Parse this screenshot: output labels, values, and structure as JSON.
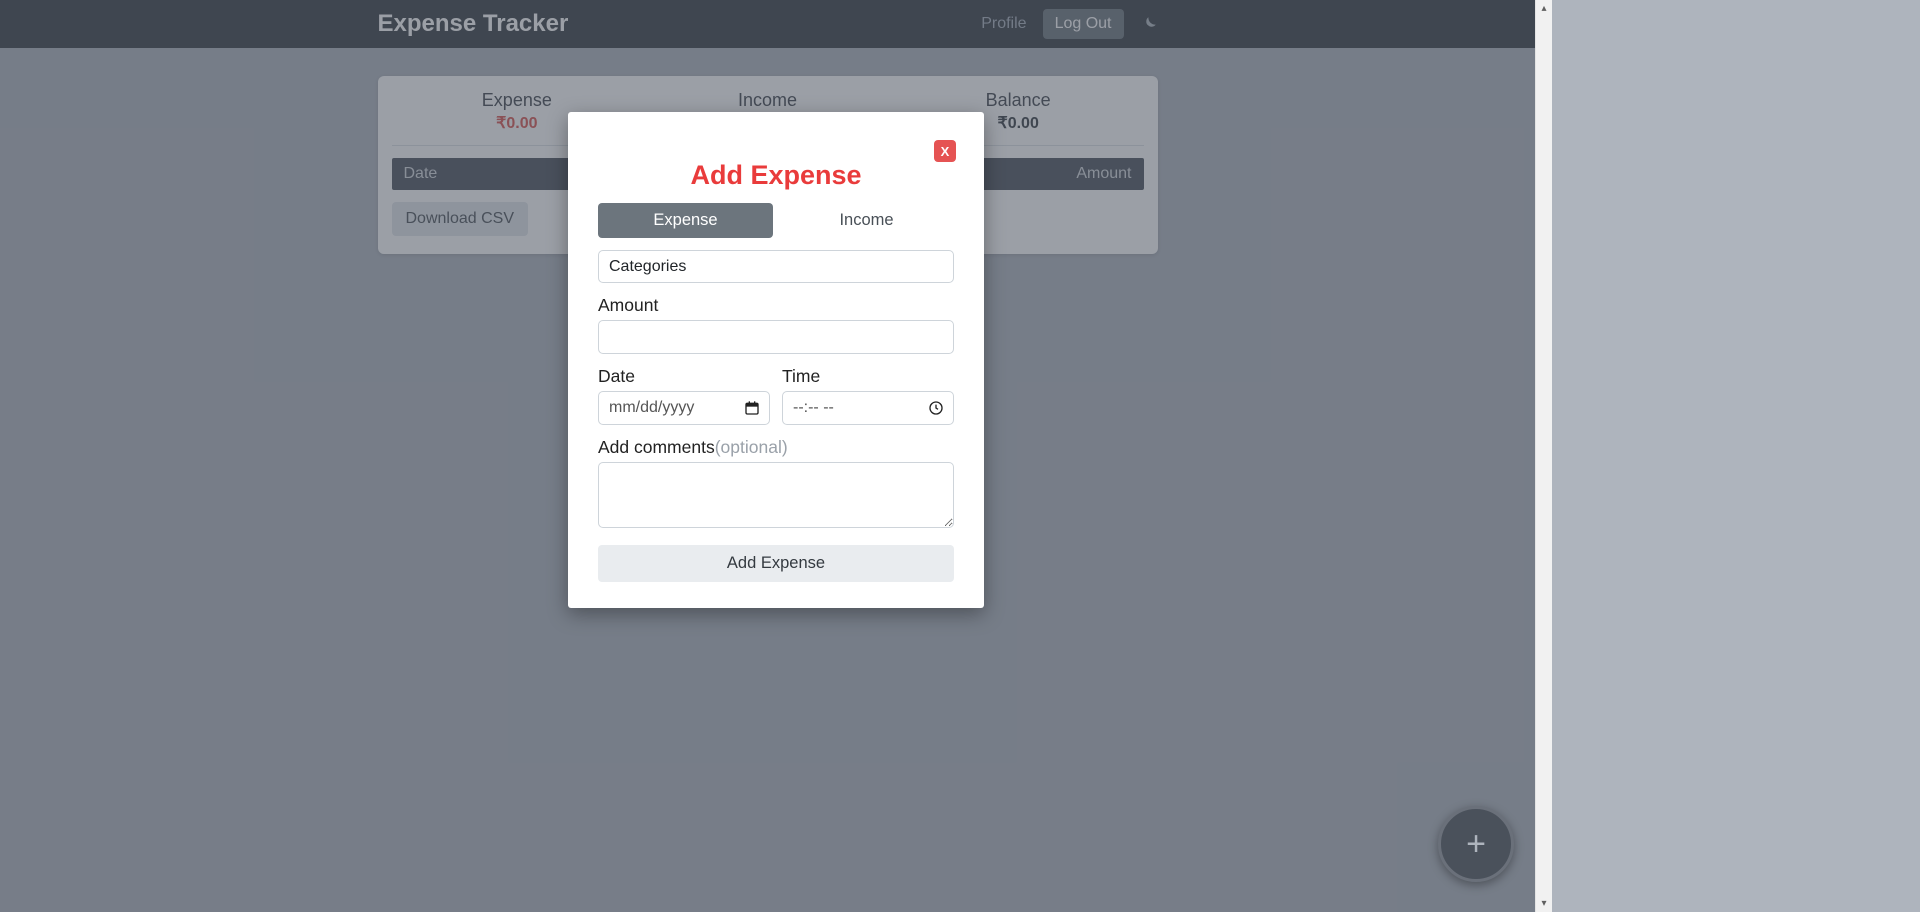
{
  "header": {
    "brand": "Expense Tracker",
    "profile": "Profile",
    "logout": "Log Out"
  },
  "summary": {
    "expense_label": "Expense",
    "expense_value": "₹0.00",
    "income_label": "Income",
    "balance_label": "Balance",
    "balance_value": "₹0.00"
  },
  "table": {
    "date_header": "Date",
    "amount_header": "Amount"
  },
  "actions": {
    "download_csv": "Download CSV",
    "fab": "+"
  },
  "modal": {
    "close": "X",
    "title": "Add Expense",
    "tabs": {
      "expense": "Expense",
      "income": "Income"
    },
    "categories_placeholder": "Categories",
    "amount_label": "Amount",
    "date_label": "Date",
    "date_placeholder": "mm/dd/yyyy",
    "time_label": "Time",
    "time_placeholder": "--:-- --",
    "comments_label": "Add comments",
    "comments_optional": "(optional)",
    "submit": "Add Expense"
  }
}
